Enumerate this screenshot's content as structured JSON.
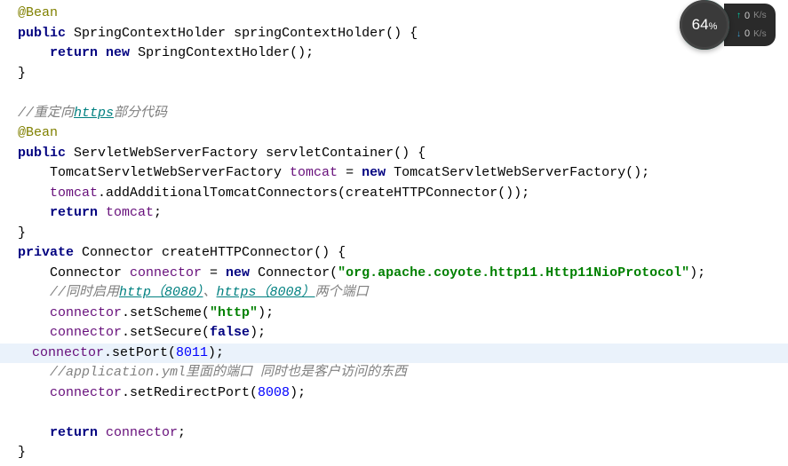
{
  "code": {
    "l1": "@Bean",
    "l2_kw1": "public",
    "l2_type": "SpringContextHolder",
    "l2_method": "springContextHolder",
    "l2_end": "() {",
    "l3_kw1": "return",
    "l3_kw2": "new",
    "l3_type": "SpringContextHolder();",
    "l4": "}",
    "l6_c1": "//重定向",
    "l6_link": "https",
    "l6_c2": "部分代码",
    "l7": "@Bean",
    "l8_kw1": "public",
    "l8_type": "ServletWebServerFactory",
    "l8_method": "servletContainer",
    "l8_end": "() {",
    "l9_type1": "TomcatServletWebServerFactory ",
    "l9_var": "tomcat",
    "l9_mid": " = ",
    "l9_kw": "new",
    "l9_type2": " TomcatServletWebServerFactory();",
    "l10_var": "tomcat",
    "l10_rest": ".addAdditionalTomcatConnectors(createHTTPConnector());",
    "l11_kw": "return",
    "l11_var": " tomcat",
    "l11_end": ";",
    "l12": "}",
    "l13_kw": "private",
    "l13_type": " Connector ",
    "l13_method": "createHTTPConnector",
    "l13_end": "() {",
    "l14_type": "Connector ",
    "l14_var": "connector",
    "l14_mid": " = ",
    "l14_kw": "new",
    "l14_type2": " Connector(",
    "l14_str": "\"org.apache.coyote.http11.Http11NioProtocol\"",
    "l14_end": ");",
    "l15_c1": "//同时启用",
    "l15_link1": "http（8080）",
    "l15_c2": "、",
    "l15_link2": "https（8008）",
    "l15_c3": "两个端口",
    "l16_var": "connector",
    "l16_mid": ".setScheme(",
    "l16_str": "\"http\"",
    "l16_end": ");",
    "l17_var": "connector",
    "l17_mid": ".setSecure(",
    "l17_kw": "false",
    "l17_end": ");",
    "l18_var": "connector",
    "l18_mid": ".setPort(",
    "l18_num": "8011",
    "l18_end": ");",
    "l19": "//application.yml里面的端口 同时也是客户访问的东西",
    "l20_var": "connector",
    "l20_mid": ".setRedirectPort(",
    "l20_num": "8008",
    "l20_end": ");",
    "l22_kw": "return",
    "l22_var": " connector",
    "l22_end": ";",
    "l23": "}"
  },
  "widget": {
    "percent": "64",
    "percent_sym": "%",
    "up_value": "0",
    "up_unit": "K/s",
    "down_value": "0",
    "down_unit": "K/s"
  }
}
